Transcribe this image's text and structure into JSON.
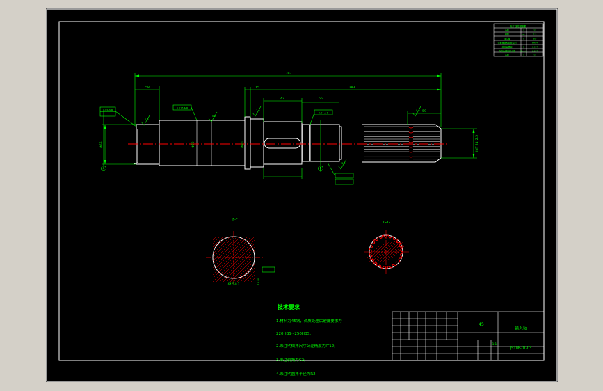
{
  "drawing": {
    "colors": {
      "background": "#000000",
      "window_bg": "#d4d0c8",
      "outline": "#ffffff",
      "dimension": "#00ff00",
      "centerline": "#ff0000",
      "hatch": "#ff0000",
      "accent": "#ffff00"
    },
    "dimensions": {
      "overall": "393",
      "left_seg": "58",
      "right_seg": "283",
      "collar": "15",
      "keyway_len": "42",
      "keyway_gap": "55",
      "spline_len": "59",
      "dia_left": "Φ55",
      "dia_mid": "Φ70",
      "dia_collar": "Φ80",
      "spline_spec": "INT 21*2.5"
    },
    "section_labels": {
      "ff": "F-F",
      "gg": "G-G",
      "ff_dim": "64.5-0.2",
      "ff_key": "18 N9"
    },
    "tolerance_frames": [
      "0.05 A-B",
      "0.015 A-B",
      "0.04 A-B"
    ],
    "datums": {
      "a": "A",
      "b": "B"
    },
    "roughness": [
      "0.8",
      "0.8",
      "1.6",
      "3.2",
      "0.8",
      "1.6",
      "0.8"
    ],
    "tech_requirements": {
      "title": "技术要求",
      "items": [
        "1.材料为45钢，调质处理后硬度要求为",
        "220HBS~250HBS;",
        "2.未注明倒角尺寸公差精度为IT12;",
        "3.未注倒角为C2;",
        "4.未注明圆角半径为R2."
      ]
    },
    "title_block": {
      "material": "45",
      "part_name": "输入轴",
      "drawing_no": "JS108-01-03",
      "scale": "1:1"
    },
    "params_table": {
      "title": "渐开线花键参数",
      "rows": [
        [
          "齿数",
          "Z",
          "21"
        ],
        [
          "模数",
          "m",
          "2.5"
        ],
        [
          "压力角",
          "α",
          "30°"
        ],
        [
          "公差等级和配合类别",
          "",
          "6H/7f"
        ],
        [
          "基本齿槽宽",
          "E",
          "3.927"
        ],
        [
          "作用齿槽宽最小值",
          "Evmin",
          "3.927"
        ],
        [
          "齿数",
          "Z",
          "21"
        ]
      ]
    }
  }
}
